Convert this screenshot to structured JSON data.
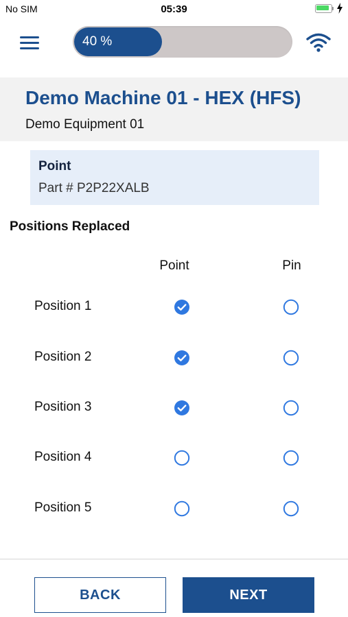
{
  "status_bar": {
    "carrier": "No SIM",
    "time": "05:39",
    "battery_level": 0.85,
    "charging": true
  },
  "header": {
    "menu_icon": "hamburger-menu-icon",
    "progress_percent": 40,
    "progress_label": "40 %",
    "connection_icon": "wifi-icon"
  },
  "machine": {
    "title": "Demo Machine 01 - HEX (HFS)",
    "subtitle": "Demo Equipment 01"
  },
  "part": {
    "name": "Point",
    "number": "Part # P2P22XALB"
  },
  "positions_section": {
    "title": "Positions Replaced",
    "columns": [
      "Point",
      "Pin"
    ],
    "rows": [
      {
        "label": "Position 1",
        "point": true,
        "pin": false
      },
      {
        "label": "Position 2",
        "point": true,
        "pin": false
      },
      {
        "label": "Position 3",
        "point": true,
        "pin": false
      },
      {
        "label": "Position 4",
        "point": false,
        "pin": false
      },
      {
        "label": "Position 5",
        "point": false,
        "pin": false
      }
    ]
  },
  "footer": {
    "back_label": "BACK",
    "next_label": "NEXT"
  },
  "colors": {
    "primary": "#1c4f8e",
    "check": "#2f78e0",
    "track": "#cdc7c7",
    "card_bg": "#e6eef9",
    "header_bg": "#f2f2f2"
  }
}
